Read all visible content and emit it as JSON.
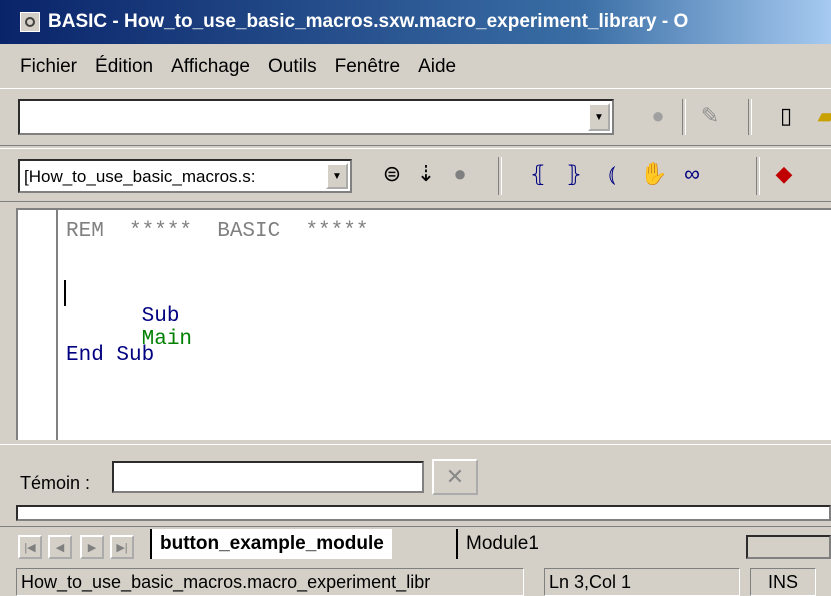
{
  "window": {
    "title": "BASIC - How_to_use_basic_macros.sxw.macro_experiment_library - O"
  },
  "menu": {
    "items": [
      "Fichier",
      "Édition",
      "Affichage",
      "Outils",
      "Fenêtre",
      "Aide"
    ]
  },
  "toolbar1": {
    "combo_value": "",
    "icons": [
      "circle-icon",
      "edit-icon",
      "new-doc-icon",
      "folder-icon"
    ]
  },
  "toolbar2": {
    "library_combo_value": "[How_to_use_basic_macros.s:",
    "icons": [
      "compile-icon",
      "run-icon",
      "stop-icon",
      "step-into-icon",
      "step-over-icon",
      "step-out-icon",
      "breakpoint-hand-icon",
      "watch-glasses-icon",
      "module-icon"
    ]
  },
  "editor": {
    "lines": [
      {
        "text": "REM  *****  BASIC  *****",
        "type": "rem"
      },
      {
        "keyword": "Sub",
        "identifier": "Main"
      },
      {
        "keyword2": "End Sub"
      }
    ]
  },
  "watch": {
    "label": "Témoin :",
    "value": ""
  },
  "tabs": {
    "active": "button_example_module",
    "inactive": "Module1"
  },
  "status": {
    "document": "How_to_use_basic_macros.macro_experiment_libr",
    "position": "Ln 3,Col 1",
    "mode": "INS"
  }
}
